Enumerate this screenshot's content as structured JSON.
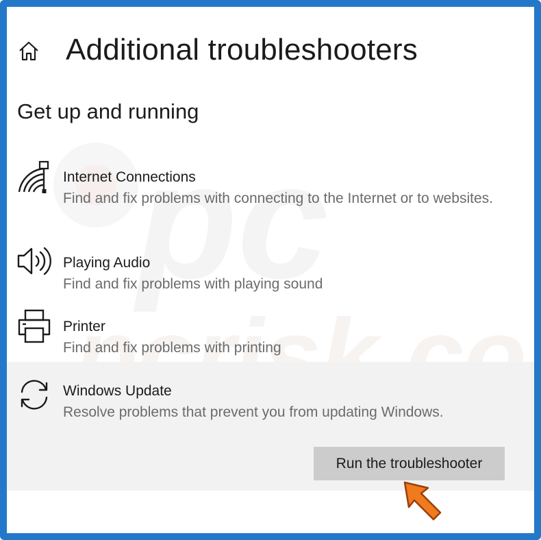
{
  "header": {
    "title": "Additional troubleshooters",
    "home_icon": "home-icon"
  },
  "section": {
    "heading": "Get up and running"
  },
  "troubleshooters": [
    {
      "name": "Internet Connections",
      "description": "Find and fix problems with connecting to the Internet or to websites.",
      "icon": "network-icon"
    },
    {
      "name": "Playing Audio",
      "description": "Find and fix problems with playing sound",
      "icon": "speaker-icon"
    },
    {
      "name": "Printer",
      "description": "Find and fix problems with printing",
      "icon": "printer-icon"
    },
    {
      "name": "Windows Update",
      "description": "Resolve problems that prevent you from updating Windows.",
      "icon": "sync-icon",
      "selected": true
    }
  ],
  "actions": {
    "run_label": "Run the troubleshooter"
  },
  "colors": {
    "frame_border": "#2478c8",
    "selected_row_bg": "#f2f2f2",
    "button_bg": "#cccccc",
    "arrow_annotation": "#f07a1e"
  },
  "watermark": {
    "text": "pcrisk.com"
  }
}
